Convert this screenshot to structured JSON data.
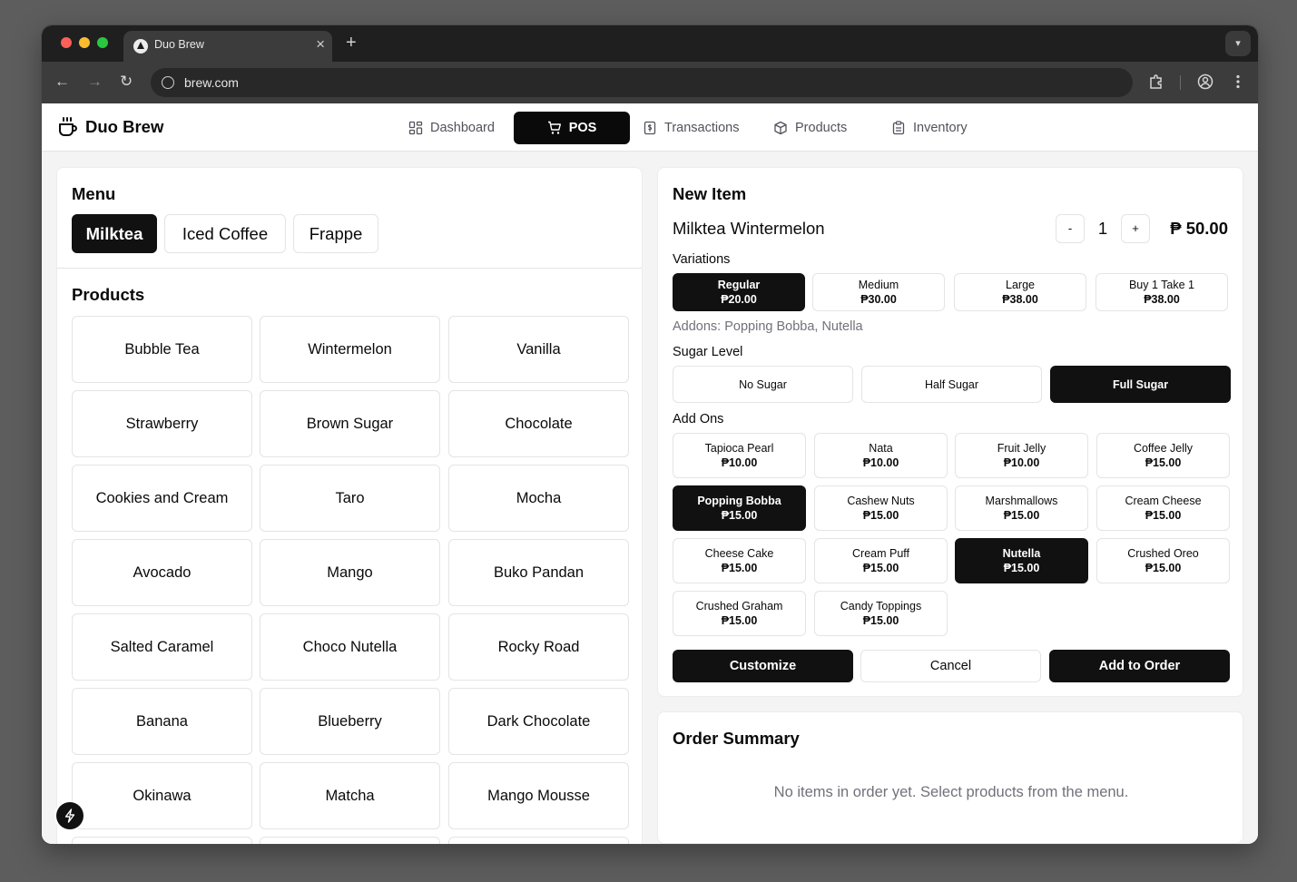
{
  "browser": {
    "tab_title": "Duo Brew",
    "url": "brew.com"
  },
  "app": {
    "brand": "Duo Brew",
    "nav": [
      {
        "label": "Dashboard",
        "icon": "dashboard-icon"
      },
      {
        "label": "POS",
        "icon": "cart-icon",
        "active": true
      },
      {
        "label": "Transactions",
        "icon": "receipt-icon"
      },
      {
        "label": "Products",
        "icon": "package-icon"
      },
      {
        "label": "Inventory",
        "icon": "clipboard-icon"
      }
    ]
  },
  "menu": {
    "title": "Menu",
    "categories": [
      {
        "label": "Milktea",
        "active": true
      },
      {
        "label": "Iced Coffee"
      },
      {
        "label": "Frappe"
      }
    ],
    "products_title": "Products",
    "products": [
      "Bubble Tea",
      "Wintermelon",
      "Vanilla",
      "Strawberry",
      "Brown Sugar",
      "Chocolate",
      "Cookies and Cream",
      "Taro",
      "Mocha",
      "Avocado",
      "Mango",
      "Buko Pandan",
      "Salted Caramel",
      "Choco Nutella",
      "Rocky Road",
      "Banana",
      "Blueberry",
      "Dark Chocolate",
      "Okinawa",
      "Matcha",
      "Mango Mousse"
    ]
  },
  "new_item": {
    "title": "New Item",
    "name": "Milktea Wintermelon",
    "qty_minus": "-",
    "qty": "1",
    "qty_plus": "+",
    "price": "₱ 50.00",
    "variations_label": "Variations",
    "variations": [
      {
        "name": "Regular",
        "price": "₱20.00",
        "selected": true
      },
      {
        "name": "Medium",
        "price": "₱30.00"
      },
      {
        "name": "Large",
        "price": "₱38.00"
      },
      {
        "name": "Buy 1 Take 1",
        "price": "₱38.00"
      }
    ],
    "addons_summary": "Addons: Popping Bobba, Nutella",
    "sugar_label": "Sugar Level",
    "sugar_levels": [
      {
        "name": "No Sugar"
      },
      {
        "name": "Half Sugar"
      },
      {
        "name": "Full Sugar",
        "selected": true
      }
    ],
    "addons_label": "Add Ons",
    "addons": [
      {
        "name": "Tapioca Pearl",
        "price": "₱10.00"
      },
      {
        "name": "Nata",
        "price": "₱10.00"
      },
      {
        "name": "Fruit Jelly",
        "price": "₱10.00"
      },
      {
        "name": "Coffee Jelly",
        "price": "₱15.00"
      },
      {
        "name": "Popping Bobba",
        "price": "₱15.00",
        "selected": true
      },
      {
        "name": "Cashew Nuts",
        "price": "₱15.00"
      },
      {
        "name": "Marshmallows",
        "price": "₱15.00"
      },
      {
        "name": "Cream Cheese",
        "price": "₱15.00"
      },
      {
        "name": "Cheese Cake",
        "price": "₱15.00"
      },
      {
        "name": "Cream Puff",
        "price": "₱15.00"
      },
      {
        "name": "Nutella",
        "price": "₱15.00",
        "selected": true
      },
      {
        "name": "Crushed Oreo",
        "price": "₱15.00"
      },
      {
        "name": "Crushed Graham",
        "price": "₱15.00"
      },
      {
        "name": "Candy Toppings",
        "price": "₱15.00"
      }
    ],
    "actions": {
      "customize": "Customize",
      "cancel": "Cancel",
      "add": "Add to Order"
    }
  },
  "order_summary": {
    "title": "Order Summary",
    "empty": "No items in order yet. Select products from the menu."
  },
  "colors": {
    "primary": "#111111",
    "muted_text": "#71717a",
    "border": "#e4e4e7",
    "background": "#f4f4f5"
  }
}
